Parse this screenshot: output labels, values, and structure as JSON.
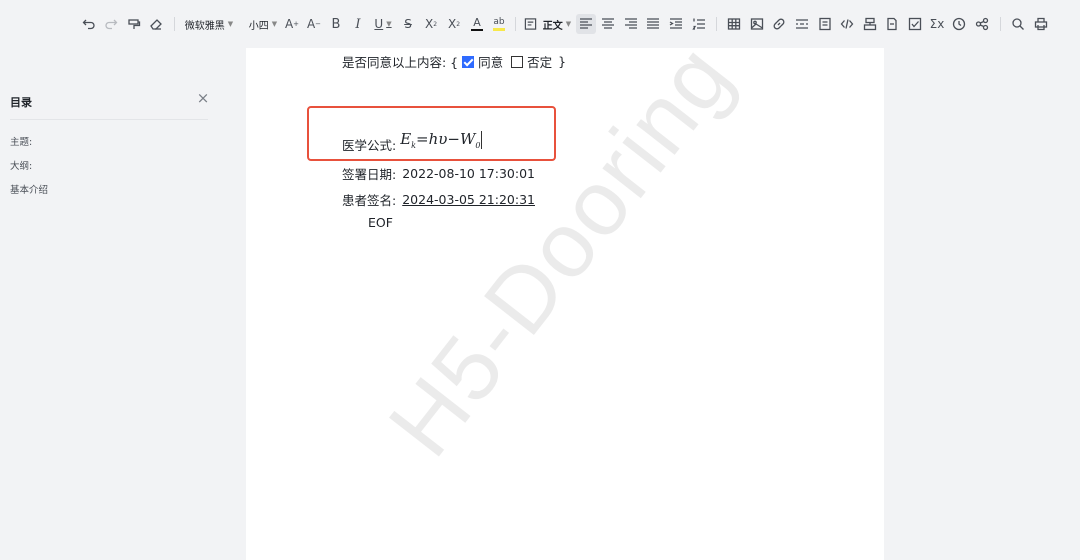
{
  "toolbar": {
    "font_family": "微软雅黑",
    "font_size": "小四",
    "paragraph_style": "正文"
  },
  "outline": {
    "title": "目录",
    "items": [
      "主题:",
      "大纲:",
      "基本介绍"
    ]
  },
  "document": {
    "consent_label": "是否同意以上内容: {",
    "agree_label": "同意",
    "agree_checked": true,
    "disagree_label": "否定",
    "disagree_checked": false,
    "consent_close": "}",
    "formula_label": "医学公式:",
    "formula": {
      "lhs": "E",
      "lhs_sub": "k",
      "rhs": "=hυ−W",
      "rhs_sub": "0"
    },
    "sign_date_label": "签署日期:",
    "sign_date_value": "2022-08-10 17:30:01",
    "patient_sign_label": "患者签名:",
    "patient_sign_value": "2024-03-05 21:20:31",
    "eof": "EOF"
  },
  "watermark": "H5-Dooring",
  "colors": {
    "highlight": "#e8513c",
    "checkbox": "#2f6bff"
  }
}
